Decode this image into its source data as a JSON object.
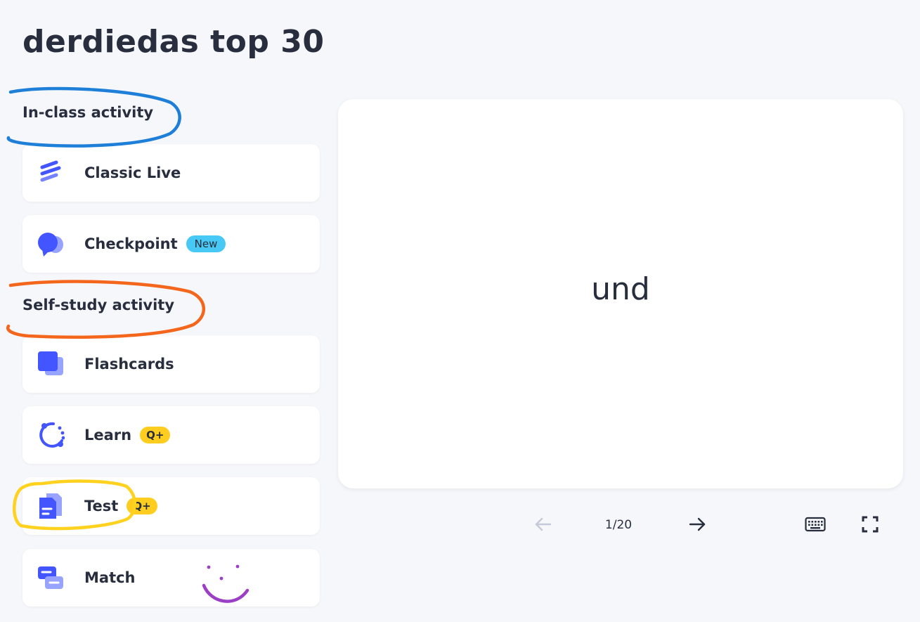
{
  "set_title": "derdiedas top 30",
  "sections": {
    "in_class": "In-class activity",
    "self_study": "Self-study activity"
  },
  "activities": {
    "classic_live": {
      "label": "Classic Live"
    },
    "checkpoint": {
      "label": "Checkpoint",
      "badge": "New"
    },
    "flashcards": {
      "label": "Flashcards"
    },
    "learn": {
      "label": "Learn",
      "badge": "Q+"
    },
    "test": {
      "label": "Test",
      "badge": "Q+"
    },
    "match": {
      "label": "Match"
    }
  },
  "flashcard": {
    "term": "und"
  },
  "navigation": {
    "counter": "1/20"
  },
  "icons": {
    "prev": "arrow-left-icon",
    "next": "arrow-right-icon",
    "keyboard": "keyboard-icon",
    "fullscreen": "fullscreen-icon"
  },
  "colors": {
    "accent": "#4255ff",
    "badge_new": "#48c8f5",
    "badge_plus": "#ffcd1f",
    "annotation_blue": "#1e7fd8",
    "annotation_orange": "#f4661b",
    "annotation_yellow": "#ffd21f",
    "annotation_purple": "#9b3fc6"
  }
}
